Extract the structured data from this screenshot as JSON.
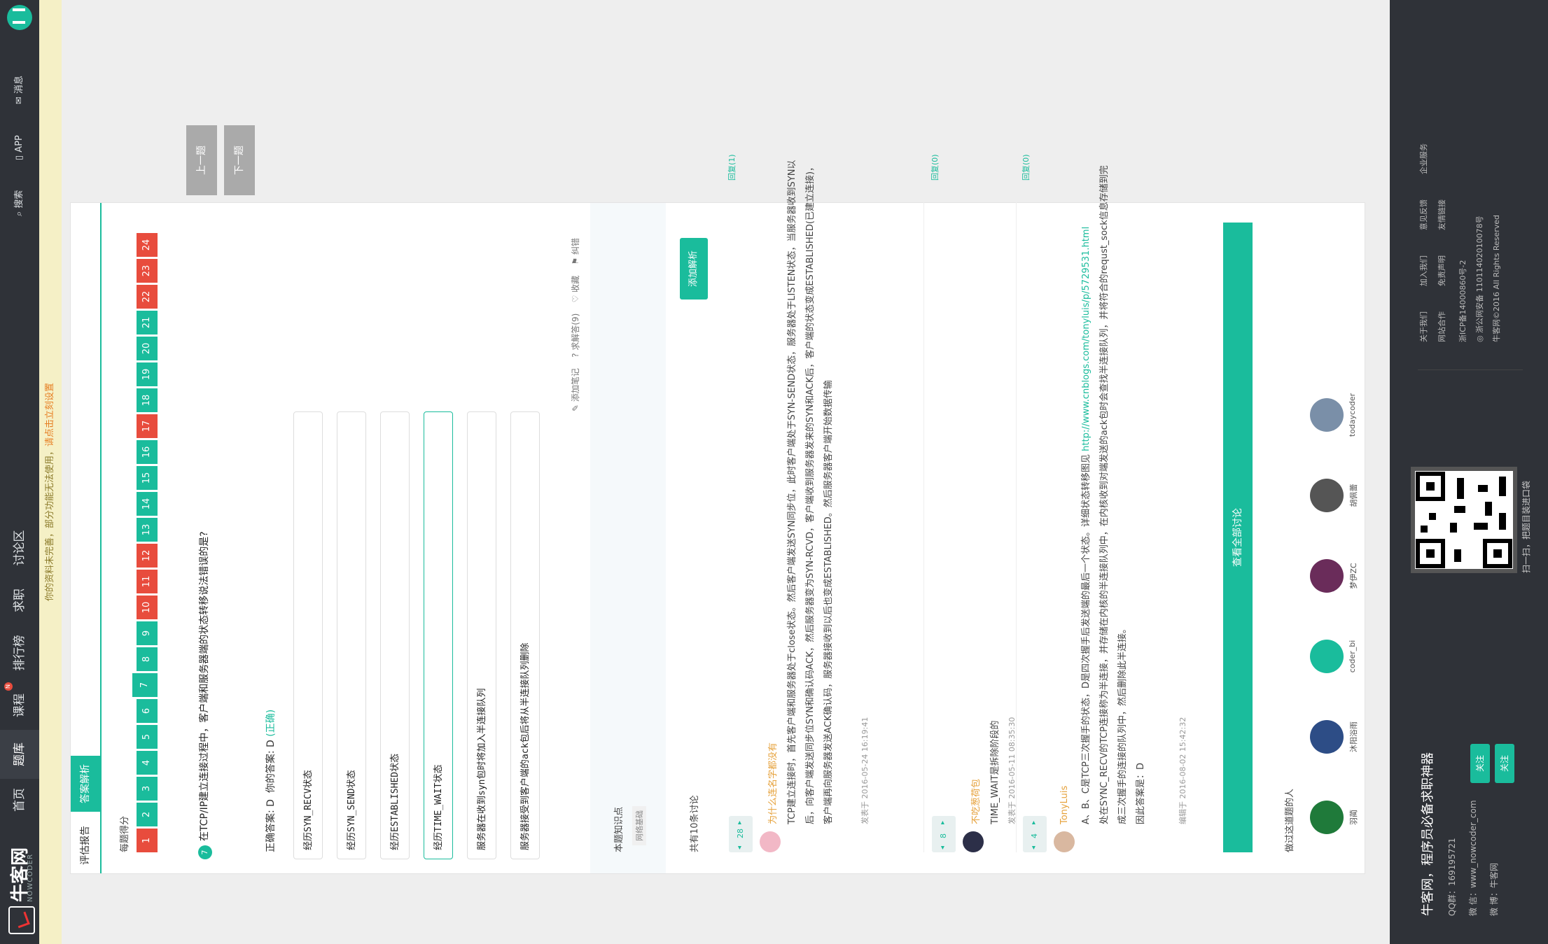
{
  "nav": {
    "brand": "牛客网",
    "brand_sub": "NOWCODER",
    "items": [
      "首页",
      "题库",
      "课程",
      "排行榜",
      "求职",
      "讨论区"
    ],
    "new_badge": "N",
    "search": "搜索",
    "app": "APP",
    "messages": "消息"
  },
  "notice": {
    "text": "你的资料未完善，部分功能无法使用，",
    "link": "请点击立刻设置"
  },
  "tabs": {
    "report": "评估报告",
    "analysis": "答案解析"
  },
  "score_label": "每题得分",
  "question_numbers": {
    "labels": [
      "1",
      "2",
      "3",
      "4",
      "5",
      "6",
      "7",
      "8",
      "9",
      "10",
      "11",
      "12",
      "13",
      "14",
      "15",
      "16",
      "17",
      "18",
      "19",
      "20",
      "21",
      "22",
      "23",
      "24"
    ],
    "status": [
      "err",
      "ok",
      "ok",
      "ok",
      "ok",
      "ok",
      "cur",
      "ok",
      "ok",
      "err",
      "err",
      "err",
      "ok",
      "ok",
      "ok",
      "ok",
      "err",
      "ok",
      "ok",
      "ok",
      "ok",
      "err",
      "err",
      "err"
    ]
  },
  "question": {
    "number": "7",
    "text": "在TCP/IP建立连接过程中，客户端和服务器端的状态转移说法错误的是?",
    "correct_label": "正确答案: D",
    "your_label": "你的答案: D",
    "your_status": "(正确)",
    "options": [
      "经历SYN_RECV状态",
      "经历SYN_SEND状态",
      "经历ESTABLISHED状态",
      "经历TIME_WAIT状态",
      "服务器在收到syn包时将加入半连接队列",
      "服务器接受到客户端的ack包后将从半连接队列删除"
    ],
    "selected_index": 3,
    "actions": {
      "note": "添加笔记",
      "help": "求解答(9)",
      "favorite": "收藏",
      "correct": "纠错"
    }
  },
  "side_buttons": {
    "prev": "上一题",
    "next": "下一题"
  },
  "knowledge": {
    "title": "本题知识点",
    "tag": "网络基础"
  },
  "discussion": {
    "count": "共有10条讨论",
    "add": "添加解析",
    "comments": [
      {
        "votes": "28",
        "name": "为什么连名字都没有",
        "body": "TCP建立连接时，首先客户端和服务器处于close状态。然后客户端发送SYN同步位，此时客户端处于SYN-SEND状态，服务器处于LISTEN状态，当服务器收到SYN以后，向客户端发送同步位SYN和确认码ACK，然后服务器变为SYN-RCVD，客户端收到服务器发来的SYN和ACK后，客户端的状态变成ESTABLISHED(已建立连接)，客户端再向服务器发送ACK确认码，服务器接收到以后也变成ESTABLISHED。然后服务器客户端开始数据传输",
        "time": "发表于 2016-05-24 16:19:41",
        "reply": "回复(1)"
      },
      {
        "votes": "8",
        "name": "不吃葱荷包",
        "body": "TIME_WAIT是拆除阶段的",
        "time": "发表于 2016-05-11 08:35:30",
        "reply": "回复(0)"
      },
      {
        "votes": "4",
        "name": "TonyLuis",
        "body_pre": "A、B、C是TCP三次握手的状态，D是四次握手后发送端的最后一个状态。详细状态转移图见 ",
        "link": "http://www.cnblogs.com/tonyluis/p/5729531.html",
        "body_post": "处在SYNC_RECV的TCP连接称为半连接，并存储在内核的半连接队列中，在内核收到对端发送的ack包时会查找半连接队列，并将符合的requst_sock信息存储到完成三次握手的连接的队列中，然后删除此半连接。",
        "extra": "因此答案是：D",
        "time": "编辑于 2016-08-02 15:42:32",
        "reply": "回复(0)"
      }
    ],
    "view_all": "查看全部讨论"
  },
  "did": {
    "title": "做过这道题的人",
    "people": [
      "羽蔺",
      "沐阳浴雨",
      "coder_bi",
      "梦伊ZC",
      "胡佩蕾",
      "todaycoder"
    ]
  },
  "footer": {
    "title": "牛客网，程序员必备求职神器",
    "qq": "QQ群：169195721",
    "wechat": "微 信：www_nowcoder_com",
    "weibo": "微 博：牛客网",
    "follow1": "关注",
    "follow2": "关注",
    "qr_caption": "扫一扫，把题目装进口袋",
    "links": [
      "关于我们",
      "加入我们",
      "意见反馈",
      "企业服务",
      "网站合作",
      "免责声明",
      "友情链接"
    ],
    "icp": "浙ICP备14000860号-2",
    "police": "浙公网安备 11011402010078号",
    "copyright": "牛客网©2016 All Rights Reserved"
  }
}
